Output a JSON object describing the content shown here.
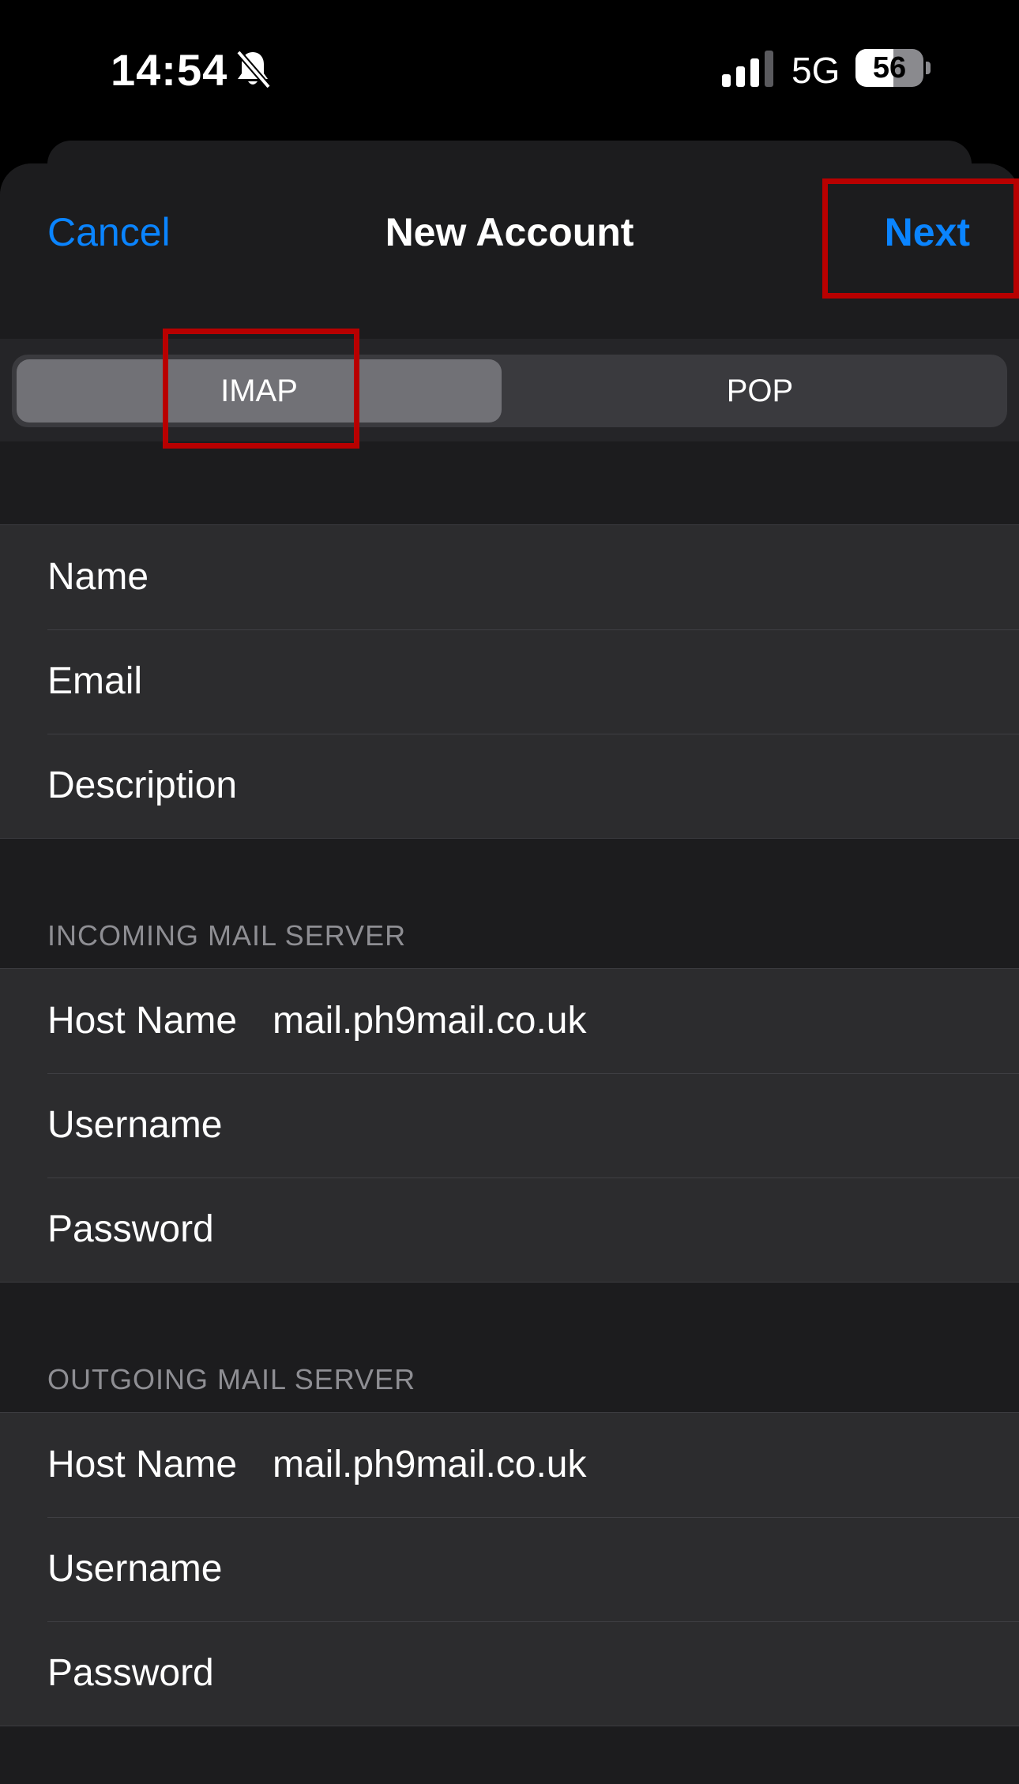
{
  "status_bar": {
    "time": "14:54",
    "network": "5G",
    "battery_level": "56",
    "battery_fraction": 0.56,
    "icons": [
      "bell-slash-icon",
      "cellular-signal-icon",
      "battery-icon"
    ]
  },
  "nav": {
    "cancel_label": "Cancel",
    "title": "New Account",
    "next_label": "Next"
  },
  "account_type": {
    "options": [
      "IMAP",
      "POP"
    ],
    "selected": "IMAP"
  },
  "account_fields": [
    {
      "label": "Name",
      "value": ""
    },
    {
      "label": "Email",
      "value": ""
    },
    {
      "label": "Description",
      "value": ""
    }
  ],
  "incoming": {
    "header": "INCOMING MAIL SERVER",
    "fields": [
      {
        "label": "Host Name",
        "value": "mail.ph9mail.co.uk"
      },
      {
        "label": "Username",
        "value": ""
      },
      {
        "label": "Password",
        "value": ""
      }
    ]
  },
  "outgoing": {
    "header": "OUTGOING MAIL SERVER",
    "fields": [
      {
        "label": "Host Name",
        "value": "mail.ph9mail.co.uk"
      },
      {
        "label": "Username",
        "value": ""
      },
      {
        "label": "Password",
        "value": ""
      }
    ]
  },
  "colors": {
    "accent": "#0a84ff",
    "annotation": "#b80000",
    "cell_background": "#2c2c2e",
    "sheet_background": "#1c1c1e"
  }
}
